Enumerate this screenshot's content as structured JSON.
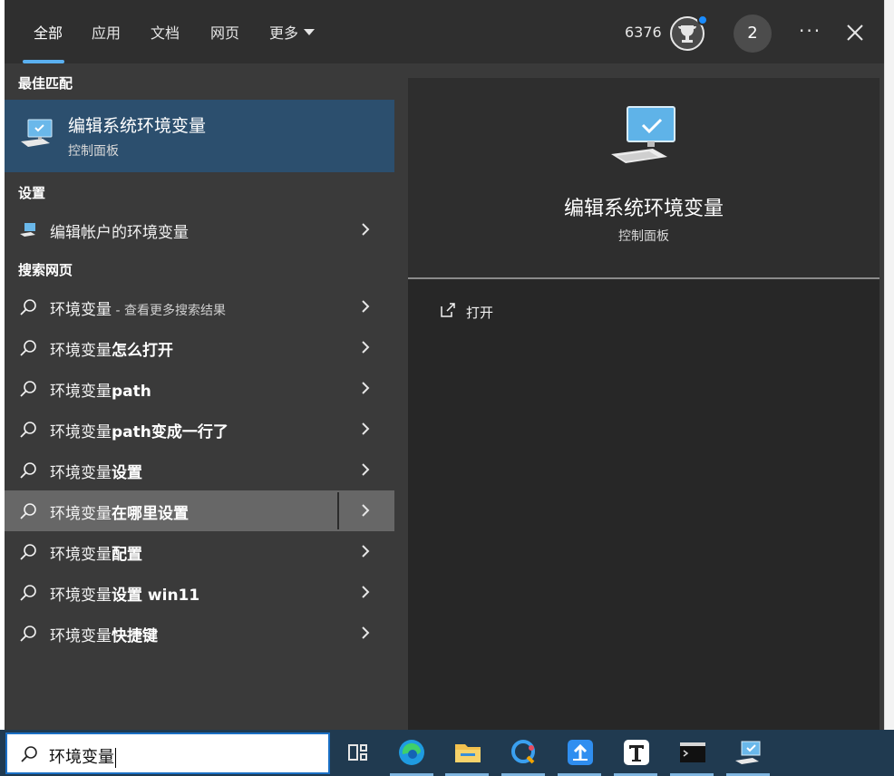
{
  "header": {
    "tabs": [
      {
        "label": "全部"
      },
      {
        "label": "应用"
      },
      {
        "label": "文档"
      },
      {
        "label": "网页"
      },
      {
        "label": "更多"
      }
    ],
    "points": "6376",
    "avatar_initial": "2",
    "more_options": "···"
  },
  "best_match": {
    "section_title": "最佳匹配",
    "title": "编辑系统环境变量",
    "subtitle": "控制面板"
  },
  "settings": {
    "section_title": "设置",
    "item_label": "编辑帐户的环境变量"
  },
  "web": {
    "section_title": "搜索网页",
    "first": {
      "query": "环境变量",
      "hint": " - 查看更多搜索结果"
    },
    "items": [
      {
        "prefix": "环境变量",
        "suffix": "怎么打开"
      },
      {
        "prefix": "环境变量",
        "suffix": "path"
      },
      {
        "prefix": "环境变量",
        "suffix": "path变成一行了"
      },
      {
        "prefix": "环境变量",
        "suffix": "设置"
      },
      {
        "prefix": "环境变量",
        "suffix": "在哪里设置"
      },
      {
        "prefix": "环境变量",
        "suffix": "配置"
      },
      {
        "prefix": "环境变量",
        "suffix": "设置 win11"
      },
      {
        "prefix": "环境变量",
        "suffix": "快捷键"
      }
    ]
  },
  "preview": {
    "title": "编辑系统环境变量",
    "subtitle": "控制面板",
    "open_label": "打开"
  },
  "taskbar": {
    "search_value": "环境变量",
    "apps": [
      "task-view-icon",
      "edge-icon",
      "file-explorer-icon",
      "chat-app-icon",
      "upload-app-icon",
      "typora-icon",
      "terminal-icon",
      "control-panel-icon"
    ]
  },
  "colors": {
    "accent": "#5ab0f0",
    "selected_bg": "#2c4f6e",
    "hover_bg": "#676767",
    "taskbar_bg": "#203a50"
  }
}
